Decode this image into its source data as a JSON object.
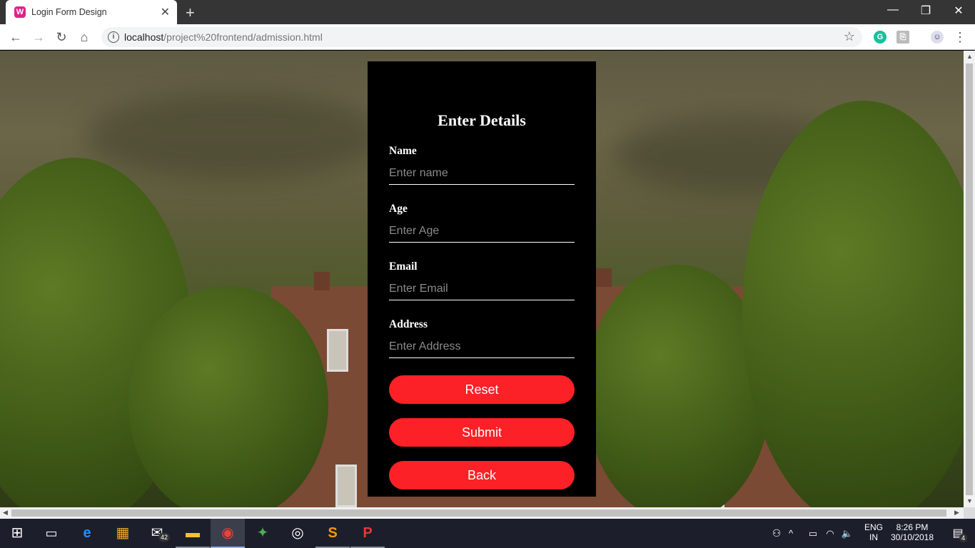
{
  "browser": {
    "tab_title": "Login Form Design",
    "url_host": "localhost",
    "url_path": "/project%20frontend/admission.html"
  },
  "form": {
    "title": "Enter Details",
    "fields": [
      {
        "label": "Name",
        "placeholder": "Enter name",
        "value": ""
      },
      {
        "label": "Age",
        "placeholder": "Enter Age",
        "value": ""
      },
      {
        "label": "Email",
        "placeholder": "Enter Email",
        "value": ""
      },
      {
        "label": "Address",
        "placeholder": "Enter Address",
        "value": ""
      }
    ],
    "buttons": {
      "reset": "Reset",
      "submit": "Submit",
      "back": "Back"
    },
    "button_color": "#fb2126",
    "background_color": "#000000"
  },
  "taskbar": {
    "mail_badge": "42",
    "language_line1": "ENG",
    "language_line2": "IN",
    "time": "8:26 PM",
    "date": "30/10/2018",
    "notification_count": "4"
  }
}
